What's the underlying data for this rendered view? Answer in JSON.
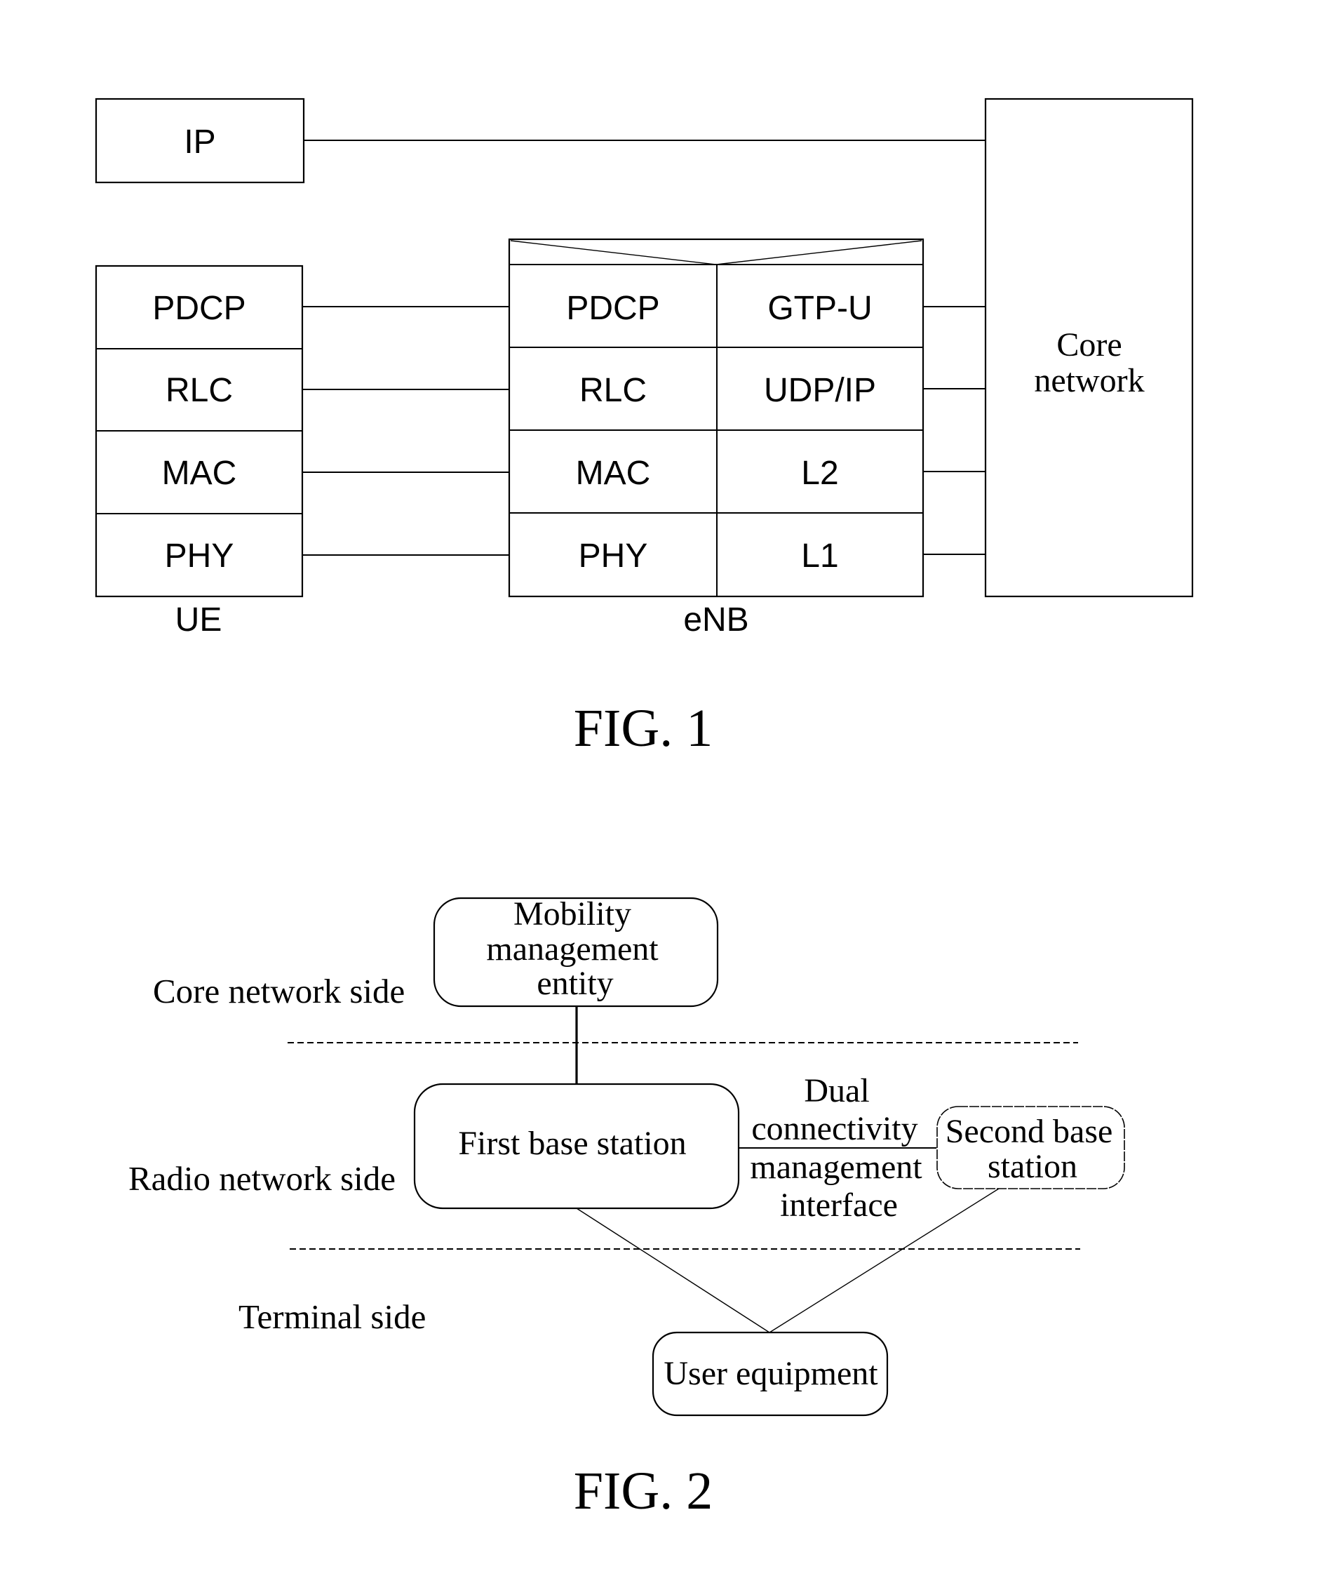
{
  "fig1": {
    "caption": "FIG. 1",
    "ip_box": {
      "label": "IP"
    },
    "ue": {
      "label": "UE",
      "layers": [
        "PDCP",
        "RLC",
        "MAC",
        "PHY"
      ]
    },
    "enb": {
      "label": "eNB",
      "left_layers": [
        "PDCP",
        "RLC",
        "MAC",
        "PHY"
      ],
      "right_layers": [
        "GTP-U",
        "UDP/IP",
        "L2",
        "L1"
      ]
    },
    "core": {
      "lines": [
        "Core",
        "network"
      ]
    }
  },
  "fig2": {
    "caption": "FIG. 2",
    "side_labels": {
      "core": "Core network side",
      "radio": "Radio network side",
      "terminal": "Terminal side"
    },
    "mme": {
      "lines": [
        "Mobility",
        "management",
        "entity"
      ]
    },
    "first_bs": {
      "label": "First base station"
    },
    "second_bs": {
      "lines": [
        "Second base",
        "station"
      ]
    },
    "interface": {
      "lines": [
        "Dual",
        "connectivity",
        "management",
        "interface"
      ]
    },
    "ue": {
      "label": "User equipment"
    }
  }
}
